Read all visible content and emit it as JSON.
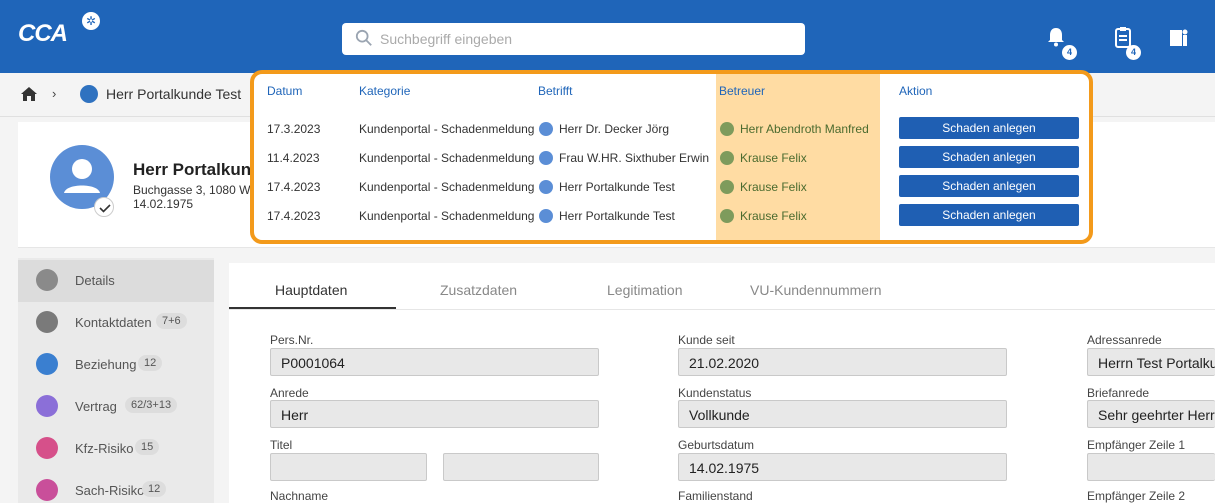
{
  "app": {
    "logo": "CCA"
  },
  "search": {
    "placeholder": "Suchbegriff eingeben"
  },
  "topbar": {
    "notifications_count": "4",
    "tasks_count": "4"
  },
  "breadcrumb": {
    "customer": "Herr Portalkunde Test"
  },
  "customer": {
    "name": "Herr Portalkun",
    "address": "Buchgasse 3, 1080 W",
    "birthdate": "14.02.1975"
  },
  "sidebar": {
    "items": [
      {
        "label": "Details",
        "count": "",
        "icon": "magnifier-icon",
        "color": "#8a8a8a"
      },
      {
        "label": "Kontaktdaten",
        "count": "7+6",
        "icon": "contact-card-icon",
        "color": "#7a7a7a"
      },
      {
        "label": "Beziehung",
        "count": "12",
        "icon": "people-icon",
        "color": "#3a7fd0"
      },
      {
        "label": "Vertrag",
        "count": "62/3+13",
        "icon": "document-icon",
        "color": "#8b6fd8"
      },
      {
        "label": "Kfz-Risiko",
        "count": "15",
        "icon": "car-icon",
        "color": "#d6508a"
      },
      {
        "label": "Sach-Risiko",
        "count": "12",
        "icon": "house-icon",
        "color": "#c94f9a"
      }
    ]
  },
  "tabs": [
    {
      "label": "Hauptdaten"
    },
    {
      "label": "Zusatzdaten"
    },
    {
      "label": "Legitimation"
    },
    {
      "label": "VU-Kundennummern"
    }
  ],
  "fields": {
    "pers_nr": {
      "label": "Pers.Nr.",
      "value": "P0001064"
    },
    "anrede": {
      "label": "Anrede",
      "value": "Herr"
    },
    "titel": {
      "label": "Titel",
      "value": ""
    },
    "nachname": {
      "label": "Nachname"
    },
    "kunde_seit": {
      "label": "Kunde seit",
      "value": "21.02.2020"
    },
    "kundenstatus": {
      "label": "Kundenstatus",
      "value": "Vollkunde"
    },
    "geburtsdatum": {
      "label": "Geburtsdatum",
      "value": "14.02.1975"
    },
    "familienstand": {
      "label": "Familienstand"
    },
    "adressanrede": {
      "label": "Adressanrede",
      "value": "Herrn Test Portalku"
    },
    "briefanrede": {
      "label": "Briefanrede",
      "value": "Sehr geehrter Herr I"
    },
    "empfaenger1": {
      "label": "Empfänger Zeile 1",
      "value": ""
    },
    "empfaenger2": {
      "label": "Empfänger Zeile 2"
    }
  },
  "popup": {
    "headers": {
      "datum": "Datum",
      "kategorie": "Kategorie",
      "betrifft": "Betrifft",
      "betreuer": "Betreuer",
      "aktion": "Aktion"
    },
    "rows": [
      {
        "datum": "17.3.2023",
        "kategorie": "Kundenportal - Schadenmeldung",
        "betrifft": "Herr Dr. Decker Jörg",
        "betreuer": "Herr Abendroth Manfred",
        "aktion": "Schaden anlegen"
      },
      {
        "datum": "11.4.2023",
        "kategorie": "Kundenportal - Schadenmeldung",
        "betrifft": "Frau W.HR. Sixthuber Erwin",
        "betreuer": "Krause Felix",
        "aktion": "Schaden anlegen"
      },
      {
        "datum": "17.4.2023",
        "kategorie": "Kundenportal - Schadenmeldung",
        "betrifft": "Herr Portalkunde Test",
        "betreuer": "Krause Felix",
        "aktion": "Schaden anlegen"
      },
      {
        "datum": "17.4.2023",
        "kategorie": "Kundenportal - Schadenmeldung",
        "betrifft": "Herr Portalkunde Test",
        "betreuer": "Krause Felix",
        "aktion": "Schaden anlegen"
      }
    ]
  },
  "colors": {
    "brand": "#1f65b9",
    "highlight": "#f39a1b",
    "betreuer_bg": "#ffdca3",
    "button": "#1f5fb3"
  }
}
